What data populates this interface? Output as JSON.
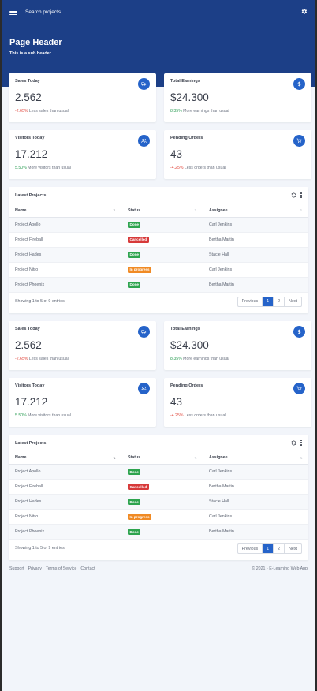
{
  "search": {
    "placeholder": "Search projects..."
  },
  "header": {
    "title": "Page Header",
    "subtitle": "This is a sub header"
  },
  "colors": {
    "header_bg": "#1c3f87",
    "accent": "#2563c9",
    "done": "#2ea44f",
    "cancelled": "#d73a3a",
    "inprogress": "#f08a24"
  },
  "sections": [
    {
      "stats": [
        {
          "title": "Sales Today",
          "value": "2.562",
          "change": "-2.65%",
          "note": " Less sales than usual",
          "trend": "down",
          "icon": "truck-icon"
        },
        {
          "title": "Total Earnings",
          "value": "$24.300",
          "change": "8.35%",
          "note": " More earnings than usual",
          "trend": "up",
          "icon": "dollar-icon"
        },
        {
          "title": "Visitors Today",
          "value": "17.212",
          "change": "5.50%",
          "note": " More visitors than usual",
          "trend": "up",
          "icon": "users-icon"
        },
        {
          "title": "Pending Orders",
          "value": "43",
          "change": "-4.25%",
          "note": " Less orders than usual",
          "trend": "down",
          "icon": "cart-icon"
        }
      ],
      "table": {
        "title": "Latest Projects",
        "columns": [
          "Name",
          "Status",
          "Assignee"
        ],
        "rows": [
          {
            "name": "Project Apollo",
            "status": "Done",
            "assignee": "Carl Jenkins"
          },
          {
            "name": "Project Fireball",
            "status": "Cancelled",
            "assignee": "Bertha Martin"
          },
          {
            "name": "Project Hades",
            "status": "Done",
            "assignee": "Stacie Hall"
          },
          {
            "name": "Project Nitro",
            "status": "In progress",
            "assignee": "Carl Jenkins"
          },
          {
            "name": "Project Phoenix",
            "status": "Done",
            "assignee": "Bertha Martin"
          }
        ],
        "showing": "Showing 1 to 5 of 9 entries",
        "pager": {
          "previous": "Previous",
          "pages": [
            "1",
            "2"
          ],
          "next": "Next",
          "current": "1"
        }
      }
    },
    {
      "stats": [
        {
          "title": "Sales Today",
          "value": "2.562",
          "change": "-2.65%",
          "note": " Less sales than usual",
          "trend": "down",
          "icon": "truck-icon"
        },
        {
          "title": "Total Earnings",
          "value": "$24.300",
          "change": "8.35%",
          "note": " More earnings than usual",
          "trend": "up",
          "icon": "dollar-icon"
        },
        {
          "title": "Visitors Today",
          "value": "17.212",
          "change": "5.50%",
          "note": " More visitors than usual",
          "trend": "up",
          "icon": "users-icon"
        },
        {
          "title": "Pending Orders",
          "value": "43",
          "change": "-4.25%",
          "note": " Less orders than usual",
          "trend": "down",
          "icon": "cart-icon"
        }
      ],
      "table": {
        "title": "Latest Projects",
        "columns": [
          "Name",
          "Status",
          "Assignee"
        ],
        "rows": [
          {
            "name": "Project Apollo",
            "status": "Done",
            "assignee": "Carl Jenkins"
          },
          {
            "name": "Project Fireball",
            "status": "Cancelled",
            "assignee": "Bertha Martin"
          },
          {
            "name": "Project Hades",
            "status": "Done",
            "assignee": "Stacie Hall"
          },
          {
            "name": "Project Nitro",
            "status": "In progress",
            "assignee": "Carl Jenkins"
          },
          {
            "name": "Project Phoenix",
            "status": "Done",
            "assignee": "Bertha Martin"
          }
        ],
        "showing": "Showing 1 to 5 of 9 entries",
        "pager": {
          "previous": "Previous",
          "pages": [
            "1",
            "2"
          ],
          "next": "Next",
          "current": "1"
        }
      }
    }
  ],
  "footer": {
    "links": [
      "Support",
      "Privacy",
      "Terms of Service",
      "Contact"
    ],
    "copyright": "© 2021 - E-Learning Web App"
  }
}
